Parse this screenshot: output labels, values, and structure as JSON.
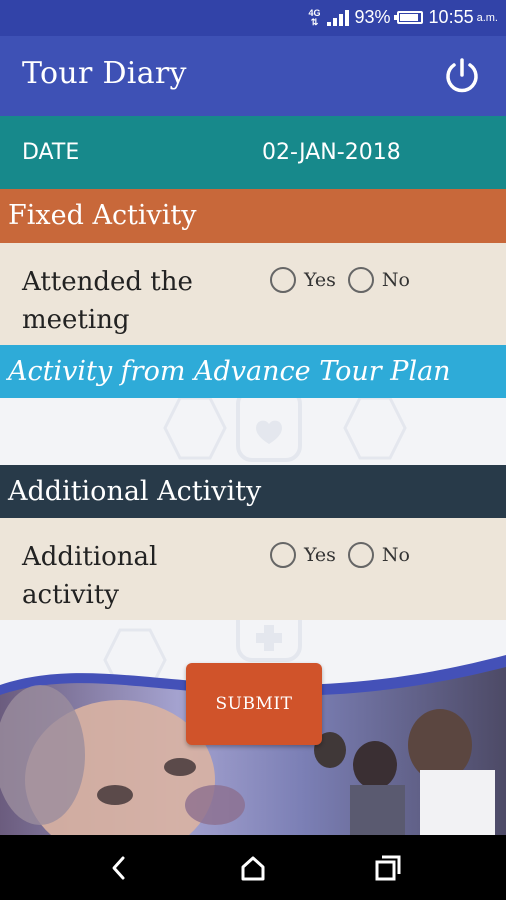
{
  "status_bar": {
    "network": "4G",
    "battery": "93%",
    "time": "10:55",
    "ampm": "a.m."
  },
  "app_bar": {
    "title": "Tour Diary",
    "power_icon": "power-icon"
  },
  "date_row": {
    "label": "DATE",
    "value": "02-JAN-2018"
  },
  "sections": {
    "fixed": {
      "title": "Fixed Activity",
      "question": "Attended the meeting",
      "options": [
        "Yes",
        "No"
      ]
    },
    "advance": {
      "title": "Activity from Advance Tour Plan"
    },
    "additional": {
      "title": "Additional Activity",
      "question": "Additional activity",
      "options": [
        "Yes",
        "No"
      ]
    }
  },
  "submit_label": "SUBMIT",
  "nav": {
    "back_icon": "back-icon",
    "home_icon": "home-icon",
    "recents_icon": "recents-icon"
  },
  "colors": {
    "status_bar": "#3243a8",
    "app_bar": "#3e51b5",
    "date_row": "#17898b",
    "fixed_head": "#c8683a",
    "advance_head": "#2eabd8",
    "additional_head": "#283a49",
    "question_bg": "#ede5d9",
    "submit": "#d0532a"
  }
}
